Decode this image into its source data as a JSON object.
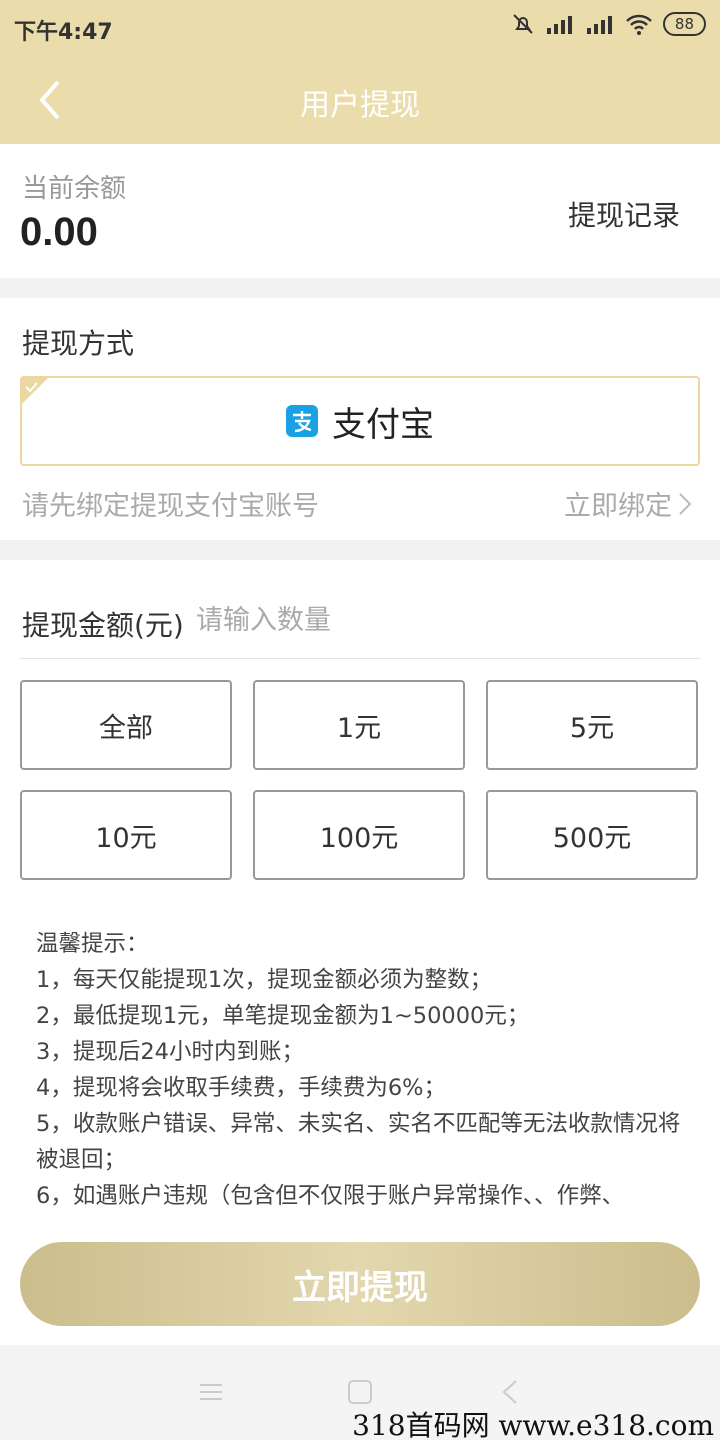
{
  "status_bar": {
    "time": "下午4:47",
    "battery": "88"
  },
  "header": {
    "title": "用户提现"
  },
  "balance": {
    "label": "当前余额",
    "value": "0.00",
    "record_link": "提现记录"
  },
  "method": {
    "label": "提现方式",
    "option": "支付宝",
    "bind_hint": "请先绑定提现支付宝账号",
    "bind_link": "立即绑定"
  },
  "amount": {
    "label": "提现金额(元)",
    "placeholder": "请输入数量",
    "options": [
      "全部",
      "1元",
      "5元",
      "10元",
      "100元",
      "500元"
    ]
  },
  "tips": [
    "温馨提示：",
    "1，每天仅能提现1次，提现金额必须为整数；",
    "2，最低提现1元，单笔提现金额为1~50000元；",
    "3，提现后24小时内到账；",
    "4，提现将会收取手续费，手续费为6%；",
    "5，收款账户错误、异常、未实名、实名不匹配等无法收款情况将被退回；",
    "6，如遇账户违规（包含但不仅限于账户异常操作、、作弊、"
  ],
  "submit_label": "立即提现",
  "watermark": "318首码网  www.e318.com",
  "colors": {
    "header_bg": "#ebdcab",
    "accent_border": "#ecd7a0",
    "alipay_blue": "#1aa1e4"
  }
}
